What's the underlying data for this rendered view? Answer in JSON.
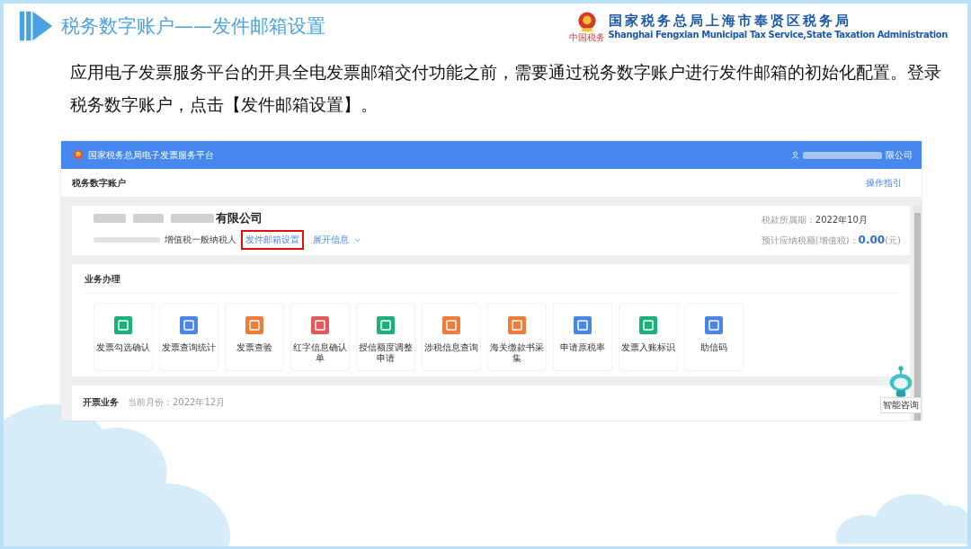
{
  "slide": {
    "title": "税务数字账户——发件邮箱设置",
    "organization": {
      "name_cn": "国家税务总局上海市奉贤区税务局",
      "name_en": "Shanghai Fengxian Municipal Tax Service,State Taxation Administration",
      "motto": "中国税务"
    },
    "paragraph": "应用电子发票服务平台的开具全电发票邮箱交付功能之前，需要通过税务数字账户进行发件邮箱的初始化配置。登录税务数字账户，点击【发件邮箱设置】。"
  },
  "screenshot": {
    "platform_title": "国家税务总局电子发票服务平台",
    "user_company": "限公司",
    "page_title": "税务数字账户",
    "guide_link": "操作指引",
    "company": {
      "name": "有限公司",
      "taxpayer_type": "增值税一般纳税人",
      "links": [
        {
          "label": "发件邮箱设置",
          "highlighted": true
        },
        {
          "label": "展开信息",
          "highlighted": false
        }
      ],
      "period_label": "税款所属期：",
      "period_value": "2022年10月",
      "tax_label": "预计应纳税额(增值税)：",
      "tax_value": "0.00",
      "tax_unit": "(元)"
    },
    "business": {
      "title": "业务办理",
      "items": [
        {
          "label": "发票勾选确认",
          "color": "#1bb27a"
        },
        {
          "label": "发票查询统计",
          "color": "#4a86e8"
        },
        {
          "label": "发票查验",
          "color": "#f07c3a"
        },
        {
          "label": "红字信息确认单",
          "color": "#e05a5a"
        },
        {
          "label": "授信额度调整申请",
          "color": "#1bb27a"
        },
        {
          "label": "涉税信息查询",
          "color": "#f07c3a"
        },
        {
          "label": "海关缴款书采集",
          "color": "#f07c3a"
        },
        {
          "label": "申请原税率",
          "color": "#4a86e8"
        },
        {
          "label": "发票入账标识",
          "color": "#1bb27a"
        },
        {
          "label": "助信码",
          "color": "#4a86e8"
        }
      ]
    },
    "invoicing": {
      "title": "开票业务",
      "month": "当前月份：2022年12月"
    },
    "assistant": {
      "label": "智能咨询"
    }
  }
}
